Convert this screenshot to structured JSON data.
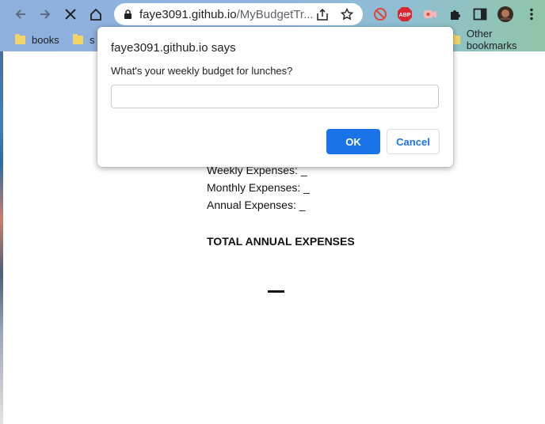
{
  "browser": {
    "url_host": "faye3091.github.io",
    "url_path": "/MyBudgetTr...",
    "bookmarks": [
      {
        "label": "books"
      },
      {
        "label": "s"
      }
    ],
    "other_bookmarks": "Other bookmarks",
    "ext_abp_label": "ABP"
  },
  "page": {
    "weekly": "Weekly Expenses: _",
    "monthly": "Monthly Expenses: _",
    "annual": "Annual Expenses: _",
    "total_heading": "TOTAL ANNUAL EXPENSES"
  },
  "dialog": {
    "title": "faye3091.github.io says",
    "message": "What's your weekly budget for lunches?",
    "input_value": "",
    "ok_label": "OK",
    "cancel_label": "Cancel"
  },
  "colors": {
    "accent": "#1a73e8",
    "chrome_bg": "#8cb3e0"
  }
}
